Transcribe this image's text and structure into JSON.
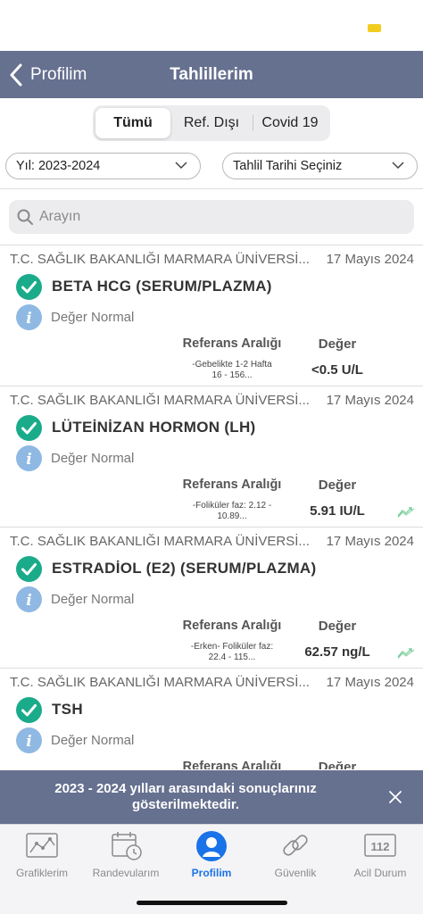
{
  "nav": {
    "back_label": "Profilim",
    "title": "Tahlillerim"
  },
  "segments": [
    "Tümü",
    "Ref. Dışı",
    "Covid 19"
  ],
  "filters": {
    "year": "Yıl: 2023-2024",
    "date": "Tahlil Tarihi Seçiniz"
  },
  "search": {
    "placeholder": "Arayın"
  },
  "labels": {
    "ref_header": "Referans Aralığı",
    "value_header": "Değer"
  },
  "results": [
    {
      "institution": "T.C. SAĞLIK BAKANLIĞI MARMARA ÜNİVERSİ...",
      "date": "17 Mayıs 2024",
      "test": "BETA HCG (SERUM/PLAZMA)",
      "status": "Değer Normal",
      "ref_line1": "-Gebelikte 1-2  Hafta",
      "ref_line2": "16    - 156...",
      "value": "<0.5 U/L",
      "trend": false
    },
    {
      "institution": "T.C. SAĞLIK BAKANLIĞI MARMARA ÜNİVERSİ...",
      "date": "17 Mayıs 2024",
      "test": "LÜTEİNİZAN HORMON (LH)",
      "status": "Değer Normal",
      "ref_line1": "-Foliküler faz:  2.12 -",
      "ref_line2": "10.89...",
      "value": "5.91 IU/L",
      "trend": true
    },
    {
      "institution": "T.C. SAĞLIK BAKANLIĞI MARMARA ÜNİVERSİ...",
      "date": "17 Mayıs 2024",
      "test": "ESTRADİOL (E2) (SERUM/PLAZMA)",
      "status": "Değer Normal",
      "ref_line1": "-Erken- Foliküler faz:",
      "ref_line2": "22.4 - 115...",
      "value": "62.57 ng/L",
      "trend": true
    },
    {
      "institution": "T.C. SAĞLIK BAKANLIĞI MARMARA ÜNİVERSİ...",
      "date": "17 Mayıs 2024",
      "test": "TSH",
      "status": "Değer Normal",
      "ref_line1": "",
      "ref_line2": "",
      "value": "",
      "trend": false
    }
  ],
  "toast": {
    "message": "2023 - 2024 yılları arasındaki sonuçlarınız gösterilmektedir."
  },
  "tabs": [
    {
      "label": "Grafiklerim",
      "icon": "chart-icon"
    },
    {
      "label": "Randevularım",
      "icon": "calendar-icon"
    },
    {
      "label": "Profilim",
      "icon": "profile-icon",
      "active": true
    },
    {
      "label": "Güvenlik",
      "icon": "link-icon"
    },
    {
      "label": "Acil Durum",
      "icon": "emergency-112-icon",
      "badge": "112"
    }
  ],
  "colors": {
    "nav": "#66708f",
    "check": "#1aab8a",
    "info": "#8fb9e3",
    "active_tab": "#1a73e8"
  }
}
